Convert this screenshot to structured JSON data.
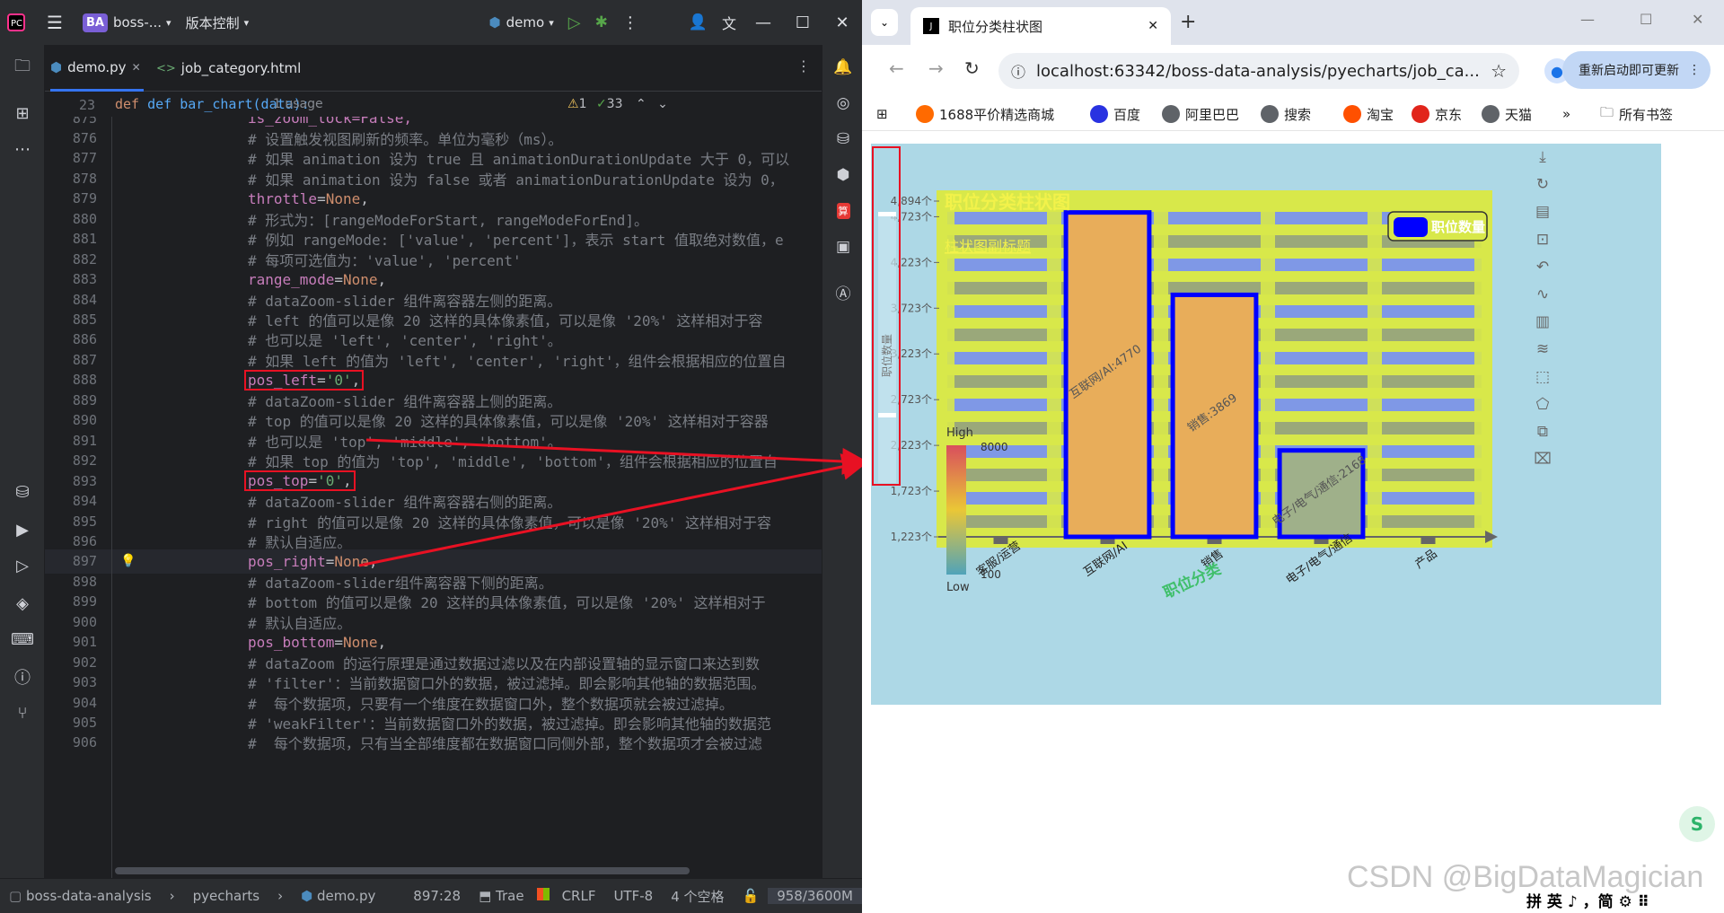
{
  "ide": {
    "project_badge": "BA",
    "project_name": "boss-...",
    "vcs_menu": "版本控制",
    "run_config": "demo",
    "tabs": [
      {
        "label": "demo.py",
        "active": true
      },
      {
        "label": "job_category.html",
        "active": false
      }
    ],
    "breadcrumb": {
      "line": "23",
      "code": "def bar_chart(data):",
      "usage": "1 usage",
      "warnings": "1",
      "checks": "33"
    },
    "lines": [
      {
        "n": "875",
        "text": "is_zoom_lock=False,",
        "kind": "assign"
      },
      {
        "n": "876",
        "text": "# 设置触发视图刷新的频率。单位为毫秒（ms）。",
        "kind": "comment"
      },
      {
        "n": "877",
        "text": "# 如果 animation 设为 true 且 animationDurationUpdate 大于 0，可以",
        "kind": "comment"
      },
      {
        "n": "878",
        "text": "# 如果 animation 设为 false 或者 animationDurationUpdate 设为 0，",
        "kind": "comment"
      },
      {
        "n": "879",
        "name": "throttle",
        "value": "None",
        "kind": "kv-none"
      },
      {
        "n": "880",
        "text": "# 形式为：[rangeModeForStart, rangeModeForEnd]。",
        "kind": "comment"
      },
      {
        "n": "881",
        "text": "# 例如 rangeMode: ['value', 'percent']，表示 start 值取绝对数值，e",
        "kind": "comment"
      },
      {
        "n": "882",
        "text": "# 每项可选值为：'value', 'percent'",
        "kind": "comment"
      },
      {
        "n": "883",
        "name": "range_mode",
        "value": "None",
        "kind": "kv-none"
      },
      {
        "n": "884",
        "text": "# dataZoom-slider 组件离容器左侧的距离。",
        "kind": "comment"
      },
      {
        "n": "885",
        "text": "# left 的值可以是像 20 这样的具体像素值，可以是像 '20%' 这样相对于容",
        "kind": "comment"
      },
      {
        "n": "886",
        "text": "# 也可以是 'left', 'center', 'right'。",
        "kind": "comment"
      },
      {
        "n": "887",
        "text": "# 如果 left 的值为 'left', 'center', 'right'，组件会根据相应的位置自",
        "kind": "comment"
      },
      {
        "n": "888",
        "name": "pos_left",
        "value": "'0'",
        "kind": "kv-str-hl"
      },
      {
        "n": "889",
        "text": "# dataZoom-slider 组件离容器上侧的距离。",
        "kind": "comment"
      },
      {
        "n": "890",
        "text": "# top 的值可以是像 20 这样的具体像素值，可以是像 '20%' 这样相对于容器",
        "kind": "comment"
      },
      {
        "n": "891",
        "text": "# 也可以是 'top', 'middle', 'bottom'。",
        "kind": "comment"
      },
      {
        "n": "892",
        "text": "# 如果 top 的值为 'top', 'middle', 'bottom'，组件会根据相应的位置自",
        "kind": "comment"
      },
      {
        "n": "893",
        "name": "pos_top",
        "value": "'0'",
        "kind": "kv-str-hl"
      },
      {
        "n": "894",
        "text": "# dataZoom-slider 组件离容器右侧的距离。",
        "kind": "comment"
      },
      {
        "n": "895",
        "text": "# right 的值可以是像 20 这样的具体像素值，可以是像 '20%' 这样相对于容",
        "kind": "comment"
      },
      {
        "n": "896",
        "text": "# 默认自适应。",
        "kind": "comment"
      },
      {
        "n": "897",
        "name": "pos_right",
        "value": "None",
        "kind": "kv-none",
        "current": true
      },
      {
        "n": "898",
        "text": "# dataZoom-slider组件离容器下侧的距离。",
        "kind": "comment"
      },
      {
        "n": "899",
        "text": "# bottom 的值可以是像 20 这样的具体像素值，可以是像 '20%' 这样相对于",
        "kind": "comment"
      },
      {
        "n": "900",
        "text": "# 默认自适应。",
        "kind": "comment"
      },
      {
        "n": "901",
        "name": "pos_bottom",
        "value": "None",
        "kind": "kv-none"
      },
      {
        "n": "902",
        "text": "# dataZoom 的运行原理是通过数据过滤以及在内部设置轴的显示窗口来达到数",
        "kind": "comment"
      },
      {
        "n": "903",
        "text": "# 'filter'：当前数据窗口外的数据，被过滤掉。即会影响其他轴的数据范围。",
        "kind": "comment"
      },
      {
        "n": "904",
        "text": "#  每个数据项，只要有一个维度在数据窗口外，整个数据项就会被过滤掉。",
        "kind": "comment"
      },
      {
        "n": "905",
        "text": "# 'weakFilter'：当前数据窗口外的数据，被过滤掉。即会影响其他轴的数据范",
        "kind": "comment"
      },
      {
        "n": "906",
        "text": "#  每个数据项，只有当全部维度都在数据窗口同侧外部，整个数据项才会被过滤",
        "kind": "comment"
      }
    ],
    "status": {
      "project": "boss-data-analysis",
      "folder": "pyecharts",
      "file": "demo.py",
      "position": "897:28",
      "plugin": "Trae",
      "line_ending": "CRLF",
      "encoding": "UTF-8",
      "indent": "4 个空格",
      "memory": "958/3600M"
    }
  },
  "browser": {
    "tab_title": "职位分类柱状图",
    "url": "localhost:63342/boss-data-analysis/pyecharts/job_ca...",
    "update_button": "重新启动即可更新",
    "bookmarks": [
      {
        "label": "1688平价精选商城",
        "color": "#ff6a00"
      },
      {
        "label": "百度",
        "color": "#2932e1"
      },
      {
        "label": "阿里巴巴",
        "color": "#5f6368"
      },
      {
        "label": "搜索",
        "color": "#5f6368"
      },
      {
        "label": "淘宝",
        "color": "#ff5000"
      },
      {
        "label": "京东",
        "color": "#e1251b"
      },
      {
        "label": "天猫",
        "color": "#5f6368"
      }
    ],
    "all_bookmarks": "所有书签",
    "watermark": "CSDN @BigDataMagician",
    "ime": "拼 英 ♪ ，简 ⚙ ⠿"
  },
  "chart_data": {
    "type": "bar",
    "title": "职位分类柱状图",
    "subtitle": "柱状图副标题",
    "legend": [
      "职位数量"
    ],
    "legend_position": "top-right",
    "ylabel": "职位数量",
    "xlabel": "职位分类",
    "categories": [
      "客服/运营",
      "互联网/AI",
      "销售",
      "电子/电气/通信",
      "产品"
    ],
    "series": [
      {
        "name": "职位数量",
        "values": [
          null,
          4770,
          3869,
          2168,
          null
        ]
      }
    ],
    "bar_labels": [
      "",
      "互联网/AI:4770",
      "销售:3869",
      "电子/电气/通信:2168",
      ""
    ],
    "y_ticks": [
      "1,223个",
      "1,723个",
      "2,223个",
      "2,723个",
      "3,223个",
      "3,723个",
      "4,223个",
      "4,723个",
      "4,894个"
    ],
    "ylim": [
      1223,
      4894
    ],
    "visual_map": {
      "high": "High",
      "low": "Low",
      "max": "8000",
      "min": "100"
    },
    "colors": {
      "background": "#add8e6",
      "grid_bg": "#d8e84a",
      "bar_fill": "#e8ad5a",
      "bar_border": "#0000ff",
      "small_bar_fill": "#9fb08a"
    }
  }
}
